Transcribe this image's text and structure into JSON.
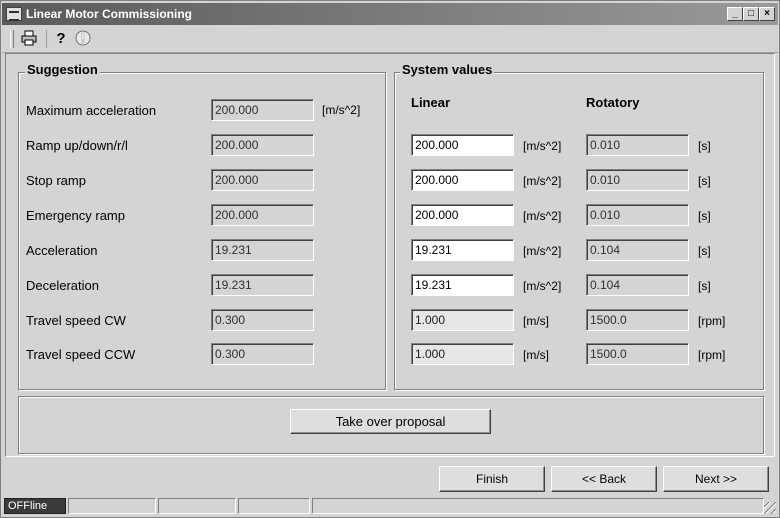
{
  "window": {
    "title": "Linear Motor Commissioning",
    "minimize": "_",
    "maximize": "□",
    "close": "×"
  },
  "toolbar": {
    "print_icon": "printer-icon",
    "help_icon": "help-icon",
    "info_icon": "info-icon",
    "help_glyph": "?",
    "info_glyph": "i"
  },
  "suggestion": {
    "legend": "Suggestion",
    "rows": [
      {
        "label": "Maximum acceleration",
        "value": "200.000",
        "unit": "[m/s^2]"
      },
      {
        "label": "Ramp up/down/r/l",
        "value": "200.000"
      },
      {
        "label": "Stop ramp",
        "value": "200.000"
      },
      {
        "label": "Emergency ramp",
        "value": "200.000"
      },
      {
        "label": "Acceleration",
        "value": "19.231"
      },
      {
        "label": "Deceleration",
        "value": "19.231"
      },
      {
        "label": "Travel speed CW",
        "value": "0.300"
      },
      {
        "label": "Travel speed CCW",
        "value": "0.300"
      }
    ]
  },
  "system": {
    "legend": "System values",
    "linear_header": "Linear",
    "rotatory_header": "Rotatory",
    "rows": [
      {
        "linear": "200.000",
        "linear_unit": "[m/s^2]",
        "rotatory": "0.010",
        "rotatory_unit": "[s]"
      },
      {
        "linear": "200.000",
        "linear_unit": "[m/s^2]",
        "rotatory": "0.010",
        "rotatory_unit": "[s]"
      },
      {
        "linear": "200.000",
        "linear_unit": "[m/s^2]",
        "rotatory": "0.010",
        "rotatory_unit": "[s]"
      },
      {
        "linear": "19.231",
        "linear_unit": "[m/s^2]",
        "rotatory": "0.104",
        "rotatory_unit": "[s]"
      },
      {
        "linear": "19.231",
        "linear_unit": "[m/s^2]",
        "rotatory": "0.104",
        "rotatory_unit": "[s]"
      },
      {
        "linear": "1.000",
        "linear_unit": "[m/s]",
        "rotatory": "1500.0",
        "rotatory_unit": "[rpm]"
      },
      {
        "linear": "1.000",
        "linear_unit": "[m/s]",
        "rotatory": "1500.0",
        "rotatory_unit": "[rpm]"
      }
    ]
  },
  "actions": {
    "take_over": "Take over proposal",
    "finish": "Finish",
    "back": "<< Back",
    "next": "Next >>"
  },
  "status": {
    "mode": "OFFline"
  }
}
